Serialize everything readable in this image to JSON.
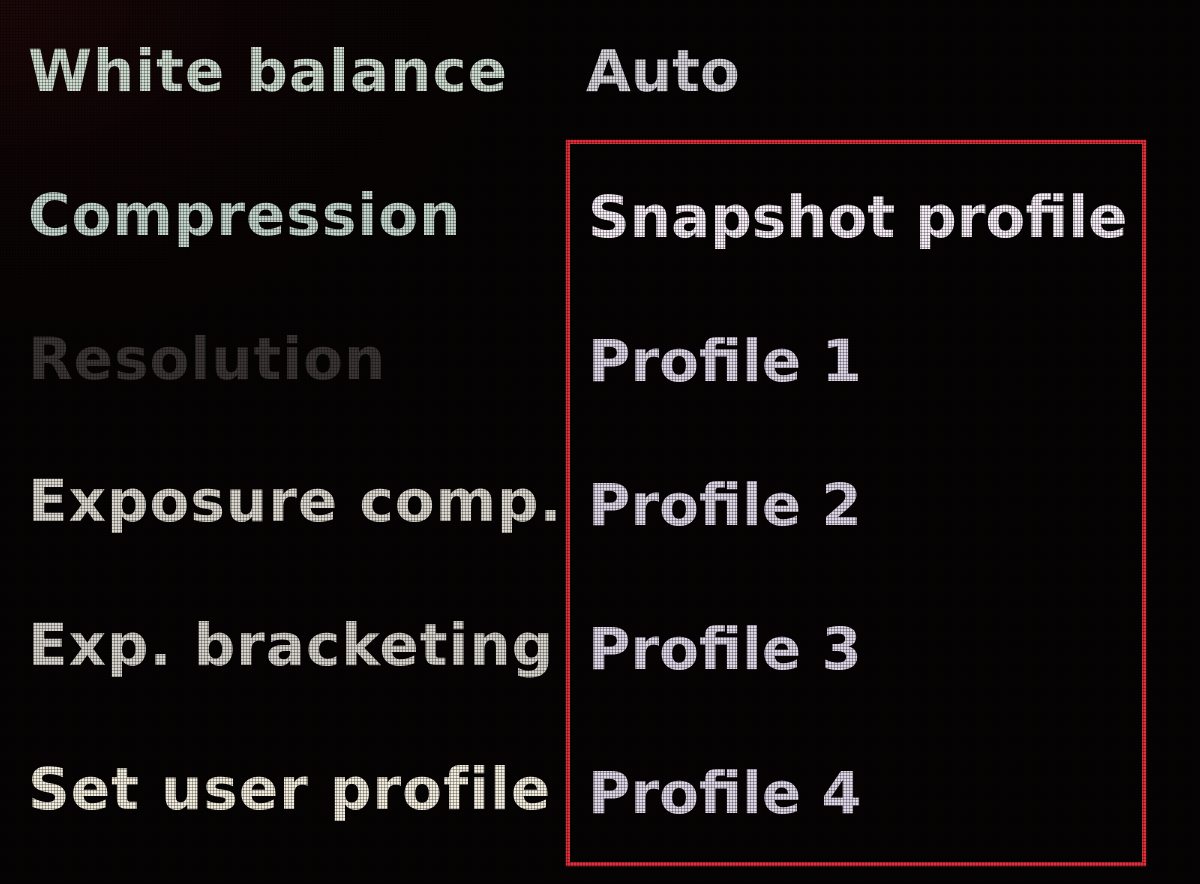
{
  "menu": {
    "items": [
      {
        "label": "White balance"
      },
      {
        "label": "Compression"
      },
      {
        "label": "Resolution",
        "state": "disabled"
      },
      {
        "label": "Exposure comp."
      },
      {
        "label": "Exp. bracketing"
      },
      {
        "label": "Set user profile",
        "state": "selected"
      }
    ],
    "white_balance_value": "Auto"
  },
  "dropdown": {
    "options": [
      {
        "label": "Snapshot profile",
        "state": "highlighted"
      },
      {
        "label": "Profile 1"
      },
      {
        "label": "Profile 2"
      },
      {
        "label": "Profile 3"
      },
      {
        "label": "Profile 4"
      }
    ],
    "border_color": "#e0303a"
  },
  "colors": {
    "background": "#060303",
    "text": "#d8d6dc",
    "disabled_text": "#3a3434"
  }
}
